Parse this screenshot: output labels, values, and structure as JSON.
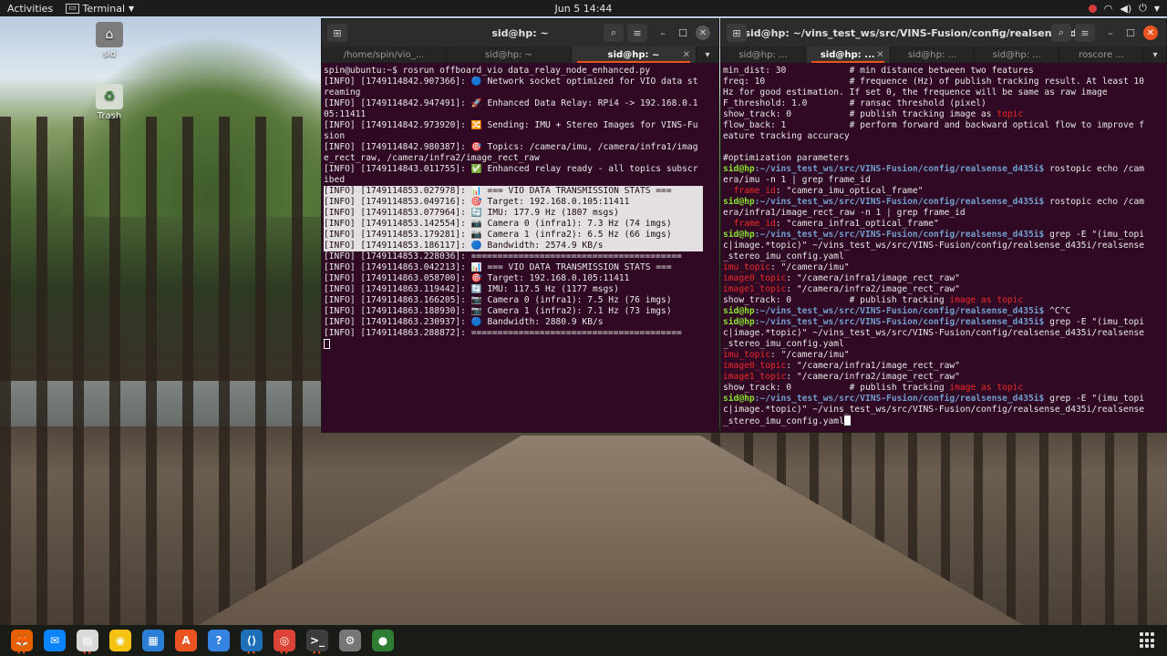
{
  "topbar": {
    "activities": "Activities",
    "app_name": "Terminal",
    "clock": "Jun 5  14:44",
    "tray_icons": [
      "notification-dot",
      "wifi-icon",
      "volume-icon",
      "power-icon",
      "chevron-down-icon"
    ]
  },
  "desktop": {
    "icons": [
      {
        "label": "sid",
        "icon": "home-folder-icon"
      },
      {
        "label": "Trash",
        "icon": "trash-icon"
      }
    ]
  },
  "left_terminal": {
    "title": "sid@hp: ~",
    "tabs": [
      {
        "label": "/home/spin/vio_...",
        "active": false
      },
      {
        "label": "sid@hp: ~",
        "active": false
      },
      {
        "label": "sid@hp: ~",
        "active": true
      }
    ],
    "lines": [
      {
        "text": "spin@ubuntu:~$ rosrun offboard_vio data_relay_node_enhanced.py",
        "hl": false
      },
      {
        "text": "[INFO] [1749114842.907366]: 🔵 Network socket optimized for VIO data st",
        "hl": false
      },
      {
        "text": "reaming",
        "hl": false
      },
      {
        "text": "[INFO] [1749114842.947491]: 🚀 Enhanced Data Relay: RPi4 -> 192.168.0.1",
        "hl": false
      },
      {
        "text": "05:11411",
        "hl": false
      },
      {
        "text": "[INFO] [1749114842.973920]: 🔀 Sending: IMU + Stereo Images for VINS-Fu",
        "hl": false
      },
      {
        "text": "sion",
        "hl": false
      },
      {
        "text": "[INFO] [1749114842.980387]: 🎯 Topics: /camera/imu, /camera/infra1/imag",
        "hl": false
      },
      {
        "text": "e_rect_raw, /camera/infra2/image_rect_raw",
        "hl": false
      },
      {
        "text": "[INFO] [1749114843.011755]: ✅ Enhanced relay ready - all topics subscr",
        "hl": false
      },
      {
        "text": "ibed",
        "hl": false
      },
      {
        "text": "[INFO] [1749114853.027978]: 📊 === VIO DATA TRANSMISSION STATS ===      ",
        "hl": true
      },
      {
        "text": "[INFO] [1749114853.049716]: 🎯 Target: 192.168.0.105:11411              ",
        "hl": true
      },
      {
        "text": "[INFO] [1749114853.077964]: 🔄 IMU: 177.9 Hz (1807 msgs)                ",
        "hl": true
      },
      {
        "text": "[INFO] [1749114853.142554]: 📷 Camera 0 (infra1): 7.3 Hz (74 imgs)      ",
        "hl": true
      },
      {
        "text": "[INFO] [1749114853.179281]: 📷 Camera 1 (infra2): 6.5 Hz (66 imgs)      ",
        "hl": true
      },
      {
        "text": "[INFO] [1749114853.186117]: 🔵 Bandwidth: 2574.9 KB/s                   ",
        "hl": true
      },
      {
        "text": "[INFO] [1749114853.228036]: ========================================",
        "hl": false
      },
      {
        "text": "[INFO] [1749114863.042213]: 📊 === VIO DATA TRANSMISSION STATS ===",
        "hl": false
      },
      {
        "text": "[INFO] [1749114863.058700]: 🎯 Target: 192.168.0.105:11411",
        "hl": false
      },
      {
        "text": "[INFO] [1749114863.119442]: 🔄 IMU: 117.5 Hz (1177 msgs)",
        "hl": false
      },
      {
        "text": "[INFO] [1749114863.166205]: 📷 Camera 0 (infra1): 7.5 Hz (76 imgs)",
        "hl": false
      },
      {
        "text": "[INFO] [1749114863.188930]: 📷 Camera 1 (infra2): 7.1 Hz (73 imgs)",
        "hl": false
      },
      {
        "text": "[INFO] [1749114863.230937]: 🔵 Bandwidth: 2880.9 KB/s",
        "hl": false
      },
      {
        "text": "[INFO] [1749114863.288872]: ========================================",
        "hl": false
      }
    ]
  },
  "right_terminal": {
    "title": "sid@hp: ~/vins_test_ws/src/VINS-Fusion/config/realsense_d...",
    "tabs": [
      {
        "label": "sid@hp: ...",
        "active": false
      },
      {
        "label": "sid@hp: ...",
        "active": true
      },
      {
        "label": "sid@hp: ...",
        "active": false
      },
      {
        "label": "sid@hp: ...",
        "active": false
      },
      {
        "label": "roscore ...",
        "active": false
      }
    ],
    "prompt_user": "sid@hp",
    "prompt_path": ":~/vins_test_ws/src/VINS-Fusion/config/realsense_d435i$",
    "lines": [
      {
        "type": "plain",
        "text": "min_dist: 30            # min distance between two features"
      },
      {
        "type": "plain",
        "text": "freq: 10                # frequence (Hz) of publish tracking result. At least 10"
      },
      {
        "type": "plain",
        "text": "Hz for good estimation. If set 0, the frequence will be same as raw image"
      },
      {
        "type": "plain",
        "text": "F_threshold: 1.0        # ransac threshold (pixel)"
      },
      {
        "type": "hlred",
        "pre": "show_track: 0           # publish tracking image as ",
        "red": "topic",
        "post": ""
      },
      {
        "type": "plain",
        "text": "flow_back: 1            # perform forward and backward optical flow to improve f"
      },
      {
        "type": "plain",
        "text": "eature tracking accuracy"
      },
      {
        "type": "plain",
        "text": ""
      },
      {
        "type": "plain",
        "text": "#optimization parameters"
      },
      {
        "type": "prompt",
        "cmd": " rostopic echo /cam"
      },
      {
        "type": "plain",
        "text": "era/imu -n 1 | grep frame_id"
      },
      {
        "type": "hlred",
        "pre": "  ",
        "red": "frame_id",
        "post": ": \"camera_imu_optical_frame\""
      },
      {
        "type": "prompt",
        "cmd": " rostopic echo /cam"
      },
      {
        "type": "plain",
        "text": "era/infra1/image_rect_raw -n 1 | grep frame_id"
      },
      {
        "type": "hlred",
        "pre": "  ",
        "red": "frame_id",
        "post": ": \"camera_infra1_optical_frame\""
      },
      {
        "type": "prompt",
        "cmd": " grep -E \"(imu_topi"
      },
      {
        "type": "plain",
        "text": "c|image.*topic)\" ~/vins_test_ws/src/VINS-Fusion/config/realsense_d435i/realsense"
      },
      {
        "type": "plain",
        "text": "_stereo_imu_config.yaml"
      },
      {
        "type": "hlred",
        "pre": "",
        "red": "imu_topic",
        "post": ": \"/camera/imu\""
      },
      {
        "type": "hlred",
        "pre": "",
        "red": "image0_topic",
        "post": ": \"/camera/infra1/image_rect_raw\""
      },
      {
        "type": "hlred",
        "pre": "",
        "red": "image1_topic",
        "post": ": \"/camera/infra2/image_rect_raw\""
      },
      {
        "type": "hlred",
        "pre": "show_track: 0           # publish tracking ",
        "red": "image as topic",
        "post": ""
      },
      {
        "type": "prompt",
        "cmd": " ^C^C"
      },
      {
        "type": "prompt",
        "cmd": " grep -E \"(imu_topi"
      },
      {
        "type": "plain",
        "text": "c|image.*topic)\" ~/vins_test_ws/src/VINS-Fusion/config/realsense_d435i/realsense"
      },
      {
        "type": "plain",
        "text": "_stereo_imu_config.yaml"
      },
      {
        "type": "hlred",
        "pre": "",
        "red": "imu_topic",
        "post": ": \"/camera/imu\""
      },
      {
        "type": "hlred",
        "pre": "",
        "red": "image0_topic",
        "post": ": \"/camera/infra1/image_rect_raw\""
      },
      {
        "type": "hlred",
        "pre": "",
        "red": "image1_topic",
        "post": ": \"/camera/infra2/image_rect_raw\""
      },
      {
        "type": "hlred",
        "pre": "show_track: 0           # publish tracking ",
        "red": "image as topic",
        "post": ""
      },
      {
        "type": "prompt",
        "cmd": " grep -E \"(imu_topi"
      },
      {
        "type": "plain",
        "text": "c|image.*topic)\" ~/vins_test_ws/src/VINS-Fusion/config/realsense_d435i/realsense"
      },
      {
        "type": "cursorline",
        "text": "_stereo_imu_config.yaml"
      }
    ]
  },
  "dock": {
    "items": [
      {
        "name": "firefox-icon",
        "glyph": "🦊",
        "bg": "#e66000",
        "running": true
      },
      {
        "name": "thunderbird-icon",
        "glyph": "✉",
        "bg": "#0a84ff",
        "running": false
      },
      {
        "name": "files-icon",
        "glyph": "▤",
        "bg": "#d9d9d9",
        "running": true
      },
      {
        "name": "rhythmbox-icon",
        "glyph": "◉",
        "bg": "#f5c211",
        "running": false
      },
      {
        "name": "libreoffice-writer-icon",
        "glyph": "▦",
        "bg": "#2a7fd4",
        "running": false
      },
      {
        "name": "software-center-icon",
        "glyph": "A",
        "bg": "#e95420",
        "running": false
      },
      {
        "name": "help-icon",
        "glyph": "?",
        "bg": "#3584e4",
        "running": false
      },
      {
        "name": "vscode-icon",
        "glyph": "⟨⟩",
        "bg": "#1f6fb8",
        "running": true
      },
      {
        "name": "chrome-icon",
        "glyph": "◎",
        "bg": "#db4437",
        "running": true
      },
      {
        "name": "terminal-icon",
        "glyph": ">_",
        "bg": "#3d3d3d",
        "running": true
      },
      {
        "name": "settings-icon",
        "glyph": "⚙",
        "bg": "#777777",
        "running": false
      },
      {
        "name": "rviz-icon",
        "glyph": "●",
        "bg": "#2e7d32",
        "running": false
      }
    ],
    "running_dots": "••"
  },
  "colors": {
    "terminal_bg": "#300a24",
    "prompt_user": "#8ae234",
    "prompt_path": "#729fcf",
    "match_red": "#ef2929",
    "accent": "#e95420"
  }
}
